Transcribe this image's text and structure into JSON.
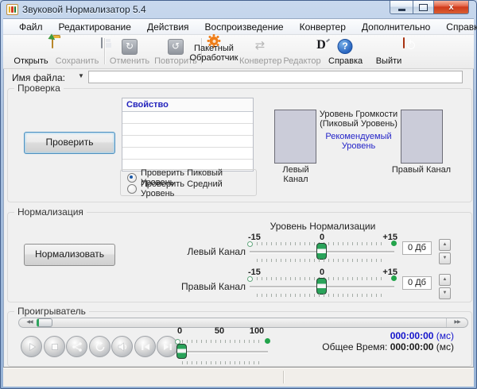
{
  "window": {
    "title": "Звуковой Нормализатор 5.4"
  },
  "menu": {
    "items": [
      "Файл",
      "Редактирование",
      "Действия",
      "Воспроизведение",
      "Конвертер",
      "Дополнительно",
      "Справка"
    ]
  },
  "toolbar": {
    "open": "Открыть",
    "save": "Сохранить",
    "undo": "Отменить",
    "redo": "Повторить",
    "batch_line1": "Пакетный",
    "batch_line2": "Обработчик",
    "converter": "Конвертер",
    "editor": "Редактор",
    "help": "Справка",
    "exit": "Выйти"
  },
  "file": {
    "label": "Имя файла:",
    "value": ""
  },
  "check": {
    "legend": "Проверка",
    "button": "Проверить",
    "table_header": "Свойство",
    "table_rows": [
      "",
      "",
      "",
      "",
      ""
    ],
    "radio1": "Проверить Пиковый Уровень",
    "radio2": "Проверить Средний Уровень",
    "meter_line1": "Уровень Громкости",
    "meter_line2": "(Пиковый Уровень)",
    "meter_link": "Рекомендуемый Уровень",
    "left_channel": "Левый Канал",
    "right_channel": "Правый Канал"
  },
  "norm": {
    "legend": "Нормализация",
    "button": "Нормализовать",
    "title": "Уровень Нормализации",
    "scale_min": "-15",
    "scale_mid": "0",
    "scale_max": "+15",
    "left_channel": "Левый Канал",
    "right_channel": "Правый Канал",
    "left_value": "0 Дб",
    "right_value": "0 Дб"
  },
  "player": {
    "legend": "Проигрыватель",
    "buttons": [
      "play",
      "stop",
      "repeat",
      "loop",
      "mute",
      "previous",
      "next"
    ],
    "volume_labels": [
      "0",
      "50",
      "100"
    ],
    "current_time": "000:00:00",
    "current_units": " (мс)",
    "total_label": "Общее Время:",
    "total_time": "000:00:00",
    "total_units": " (мс)"
  },
  "icons": {
    "dropdown": "▼",
    "spin_up": "▲",
    "spin_down": "▼",
    "seek_left": "◀◀",
    "seek_right": "▶▶",
    "undo_glyph": "↻",
    "redo_glyph": "↺",
    "converter_glyph": "⇄"
  },
  "colors": {
    "accent_green": "#23a44b",
    "link_blue": "#2424c8",
    "time_blue": "#1414cc",
    "header_blue": "#2323bd"
  },
  "statusbar": {
    "cell1": "",
    "cell2": ""
  }
}
